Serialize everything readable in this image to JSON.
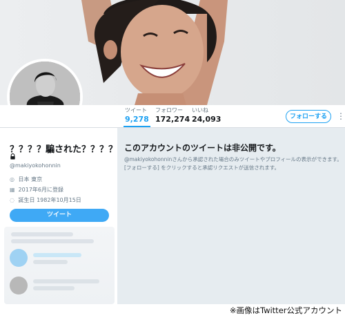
{
  "nav": {
    "tweets": {
      "label": "ツイート",
      "value": "9,278"
    },
    "following": {
      "label": "フォロワー",
      "value": "172,274"
    },
    "likes": {
      "label": "いいね",
      "value": "24,093"
    },
    "follow_button": "フォローする",
    "more_button": "⋮"
  },
  "profile": {
    "name": "？？？？騙された？？？？",
    "handle": "@makiyokohonnin",
    "location": "日本 東京",
    "joined": "2017年6月に登録",
    "birthday": "誕生日 1982年10月15日",
    "icons": {
      "location": "location-pin-icon",
      "joined": "calendar-icon",
      "birthday": "balloon-icon",
      "lock": "lock-icon"
    },
    "tweet_button": "ツイート"
  },
  "main": {
    "title": "このアカウントのツイートは非公開です。",
    "description": "@makiyokohonninさんから承認された場合のみツイートやプロフィールの表示ができます。[フォローする] をクリックすると承認リクエストが送信されます。"
  },
  "caption": "※画像はTwitter公式アカウント",
  "colors": {
    "accent": "#1da1f2",
    "main_bg": "#e6ecf0"
  }
}
